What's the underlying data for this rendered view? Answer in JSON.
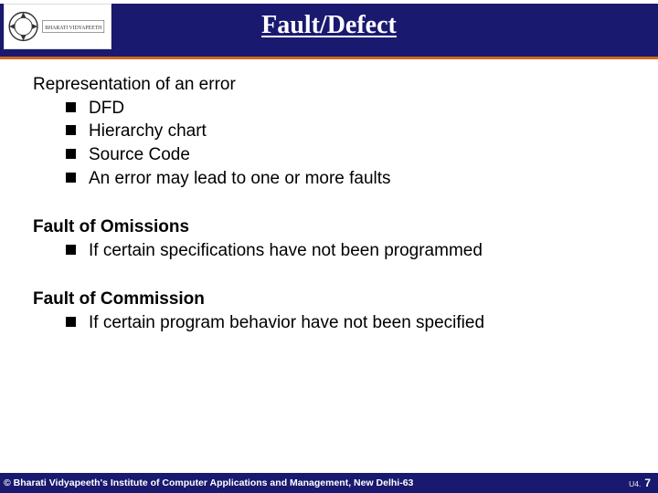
{
  "title": "Fault/Defect",
  "section1": {
    "head": "Representation of an error",
    "bullets": [
      "DFD",
      "Hierarchy chart",
      "Source Code",
      "An error may lead to one or more faults"
    ]
  },
  "section2": {
    "head": "Fault of Omissions",
    "bullets": [
      "If certain specifications have not been programmed"
    ]
  },
  "section3": {
    "head": "Fault of Commission",
    "bullets": [
      "If certain program behavior have not been specified"
    ]
  },
  "footer": {
    "copyright": "© Bharati Vidyapeeth's Institute of Computer Applications and Management, New Delhi-63",
    "unit": "U4.",
    "page": "7"
  }
}
